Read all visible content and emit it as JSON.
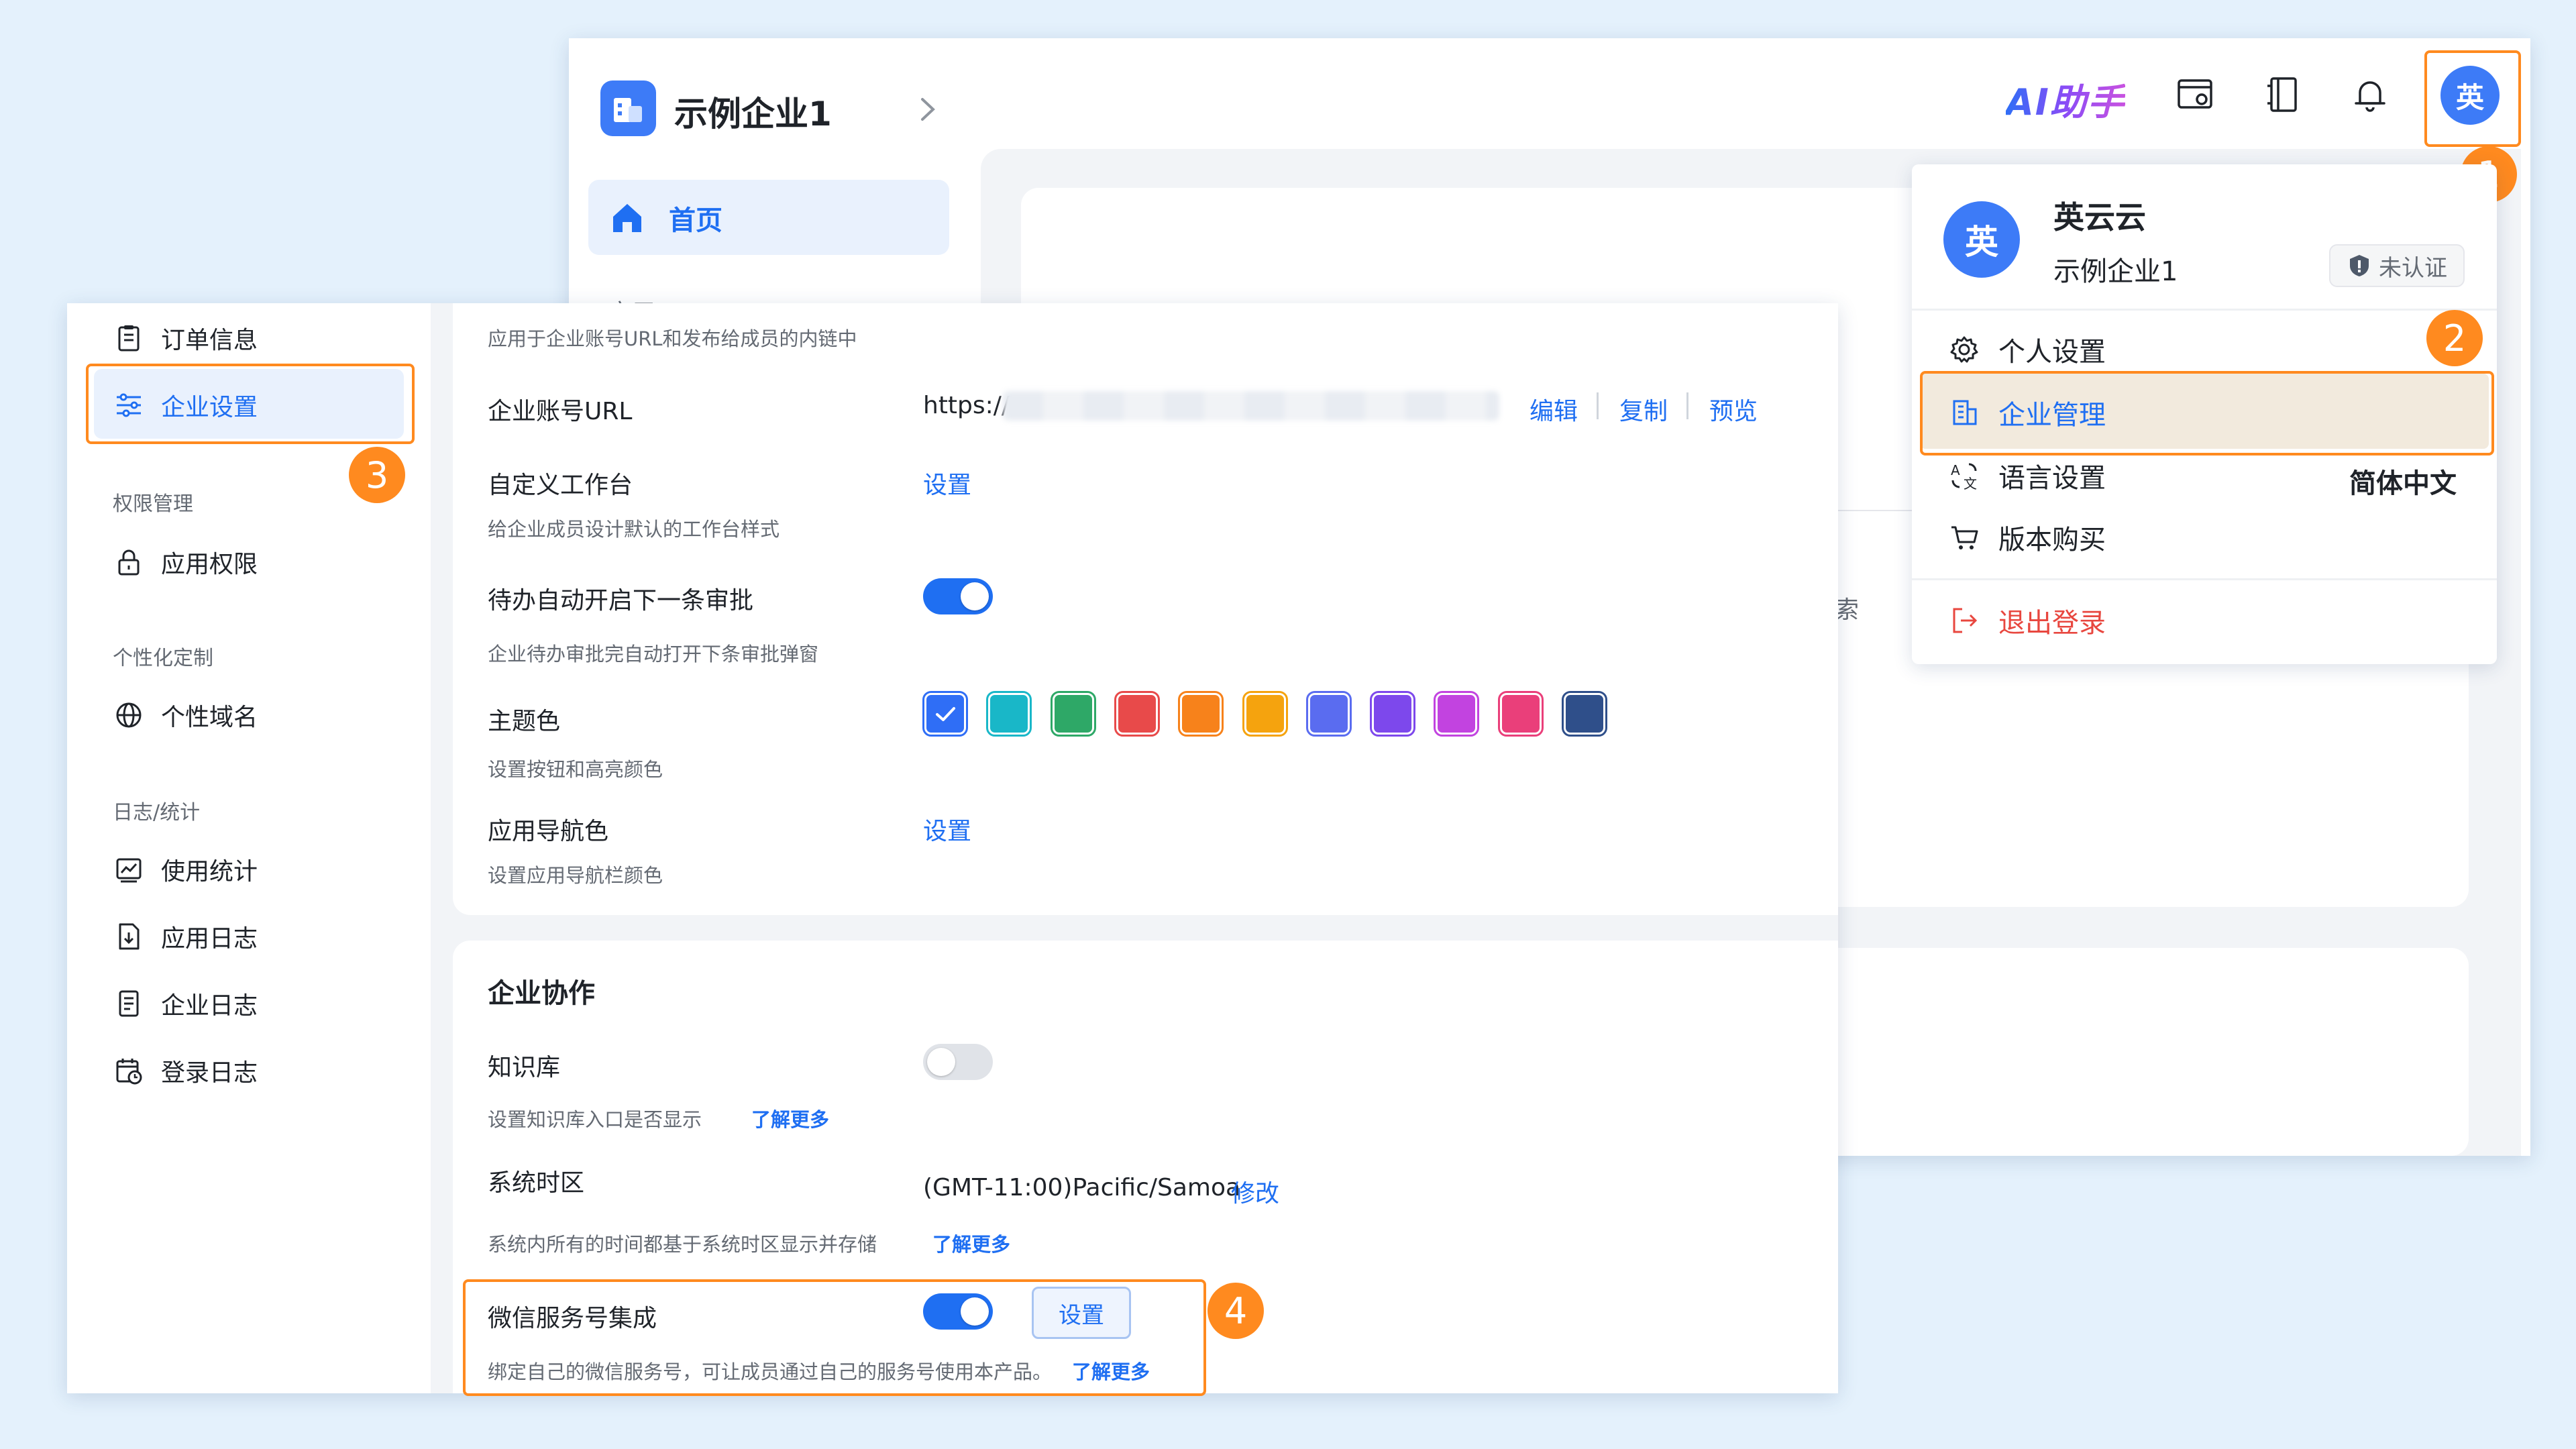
{
  "back": {
    "company_name": "示例企业1",
    "home_label": "首页",
    "apps_label_partial": "应用",
    "ai_brand": "AI助手",
    "avatar_char": "英",
    "search_partial": "索"
  },
  "dropdown": {
    "avatar_char": "英",
    "user_name": "英云云",
    "company": "示例企业1",
    "cert_badge": "未认证",
    "items": {
      "personal": "个人设置",
      "enterprise": "企业管理",
      "language": "语言设置",
      "language_value": "简体中文",
      "purchase": "版本购买",
      "logout": "退出登录"
    }
  },
  "nav": {
    "order_info": "订单信息",
    "enterprise_settings": "企业设置",
    "group_permission": "权限管理",
    "app_permission": "应用权限",
    "group_custom": "个性化定制",
    "custom_domain": "个性域名",
    "group_log": "日志/统计",
    "usage_stats": "使用统计",
    "app_log": "应用日志",
    "enterprise_log": "企业日志",
    "login_log": "登录日志"
  },
  "settings": {
    "top_desc": "应用于企业账号URL和发布给成员的内链中",
    "account_url": {
      "label": "企业账号URL",
      "value_prefix": "https://",
      "edit": "编辑",
      "copy": "复制",
      "preview": "预览"
    },
    "custom_workbench": {
      "label": "自定义工作台",
      "action": "设置",
      "desc": "给企业成员设计默认的工作台样式"
    },
    "auto_next": {
      "label": "待办自动开启下一条审批",
      "desc": "企业待办审批完自动打开下条审批弹窗",
      "enabled": true
    },
    "theme": {
      "label": "主题色",
      "desc": "设置按钮和高亮颜色",
      "colors": [
        "#2f6ef6",
        "#19b7c8",
        "#2ea867",
        "#e84a4a",
        "#f7821b",
        "#f5a30e",
        "#5a6cf0",
        "#7d48ec",
        "#c243e0",
        "#ea3f7a",
        "#2f4f8a"
      ],
      "selected_index": 0
    },
    "nav_color": {
      "label": "应用导航色",
      "action": "设置",
      "desc": "设置应用导航栏颜色"
    },
    "collab_title": "企业协作",
    "knowledge": {
      "label": "知识库",
      "desc": "设置知识库入口是否显示",
      "more": "了解更多",
      "enabled": false
    },
    "timezone": {
      "label": "系统时区",
      "value": "(GMT-11:00)Pacific/Samoa",
      "edit": "修改",
      "desc": "系统内所有的时间都基于系统时区显示并存储",
      "more": "了解更多"
    },
    "wechat": {
      "label": "微信服务号集成",
      "action": "设置",
      "desc": "绑定自己的微信服务号，可让成员通过自己的服务号使用本产品。",
      "more": "了解更多",
      "enabled": true
    }
  },
  "steps": [
    "1",
    "2",
    "3",
    "4"
  ],
  "colors": {
    "accent": "#1f6ff2",
    "highlight": "#ff8a1f",
    "danger": "#e8473f"
  }
}
